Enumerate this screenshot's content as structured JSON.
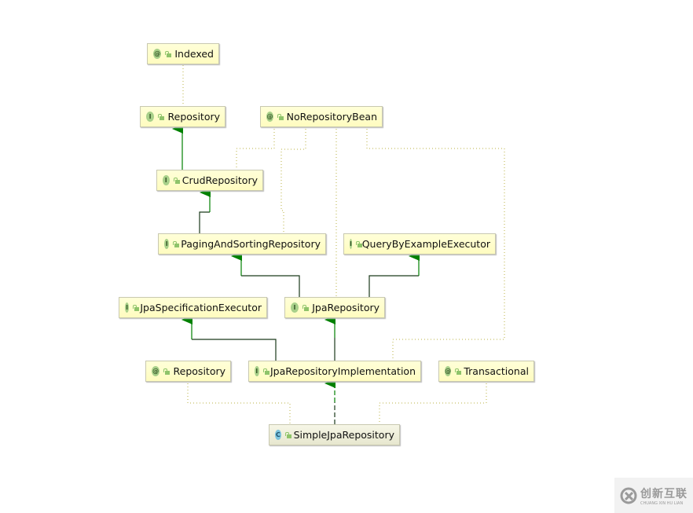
{
  "nodes": [
    {
      "id": "indexed",
      "kind": "annotation",
      "badge": "@",
      "label": "Indexed"
    },
    {
      "id": "repository",
      "kind": "interface",
      "badge": "I",
      "label": "Repository"
    },
    {
      "id": "norepositorybean",
      "kind": "annotation",
      "badge": "@",
      "label": "NoRepositoryBean"
    },
    {
      "id": "crudrepository",
      "kind": "interface",
      "badge": "I",
      "label": "CrudRepository"
    },
    {
      "id": "pagingandsorting",
      "kind": "interface",
      "badge": "I",
      "label": "PagingAndSortingRepository"
    },
    {
      "id": "querybyexample",
      "kind": "interface",
      "badge": "I",
      "label": "QueryByExampleExecutor"
    },
    {
      "id": "jpaspecification",
      "kind": "interface",
      "badge": "I",
      "label": "JpaSpecificationExecutor"
    },
    {
      "id": "jparepository",
      "kind": "interface",
      "badge": "I",
      "label": "JpaRepository"
    },
    {
      "id": "repositoryannotation",
      "kind": "annotation",
      "badge": "@",
      "label": "Repository"
    },
    {
      "id": "jparepoimpl",
      "kind": "interface",
      "badge": "I",
      "label": "JpaRepositoryImplementation"
    },
    {
      "id": "transactional",
      "kind": "annotation",
      "badge": "@",
      "label": "Transactional"
    },
    {
      "id": "simplejparepository",
      "kind": "class",
      "badge": "C",
      "label": "SimpleJpaRepository"
    }
  ],
  "edges": [
    {
      "from": "indexed",
      "to": "repository",
      "type": "annotation"
    },
    {
      "from": "crudrepository",
      "to": "repository",
      "type": "extends"
    },
    {
      "from": "pagingandsorting",
      "to": "crudrepository",
      "type": "extends"
    },
    {
      "from": "jparepository",
      "to": "pagingandsorting",
      "type": "extends"
    },
    {
      "from": "jparepository",
      "to": "querybyexample",
      "type": "extends"
    },
    {
      "from": "jparepoimpl",
      "to": "jpaspecification",
      "type": "extends"
    },
    {
      "from": "jparepoimpl",
      "to": "jparepository",
      "type": "extends"
    },
    {
      "from": "simplejparepository",
      "to": "jparepoimpl",
      "type": "implements"
    },
    {
      "from": "norepositorybean",
      "to": "crudrepository",
      "type": "annotation"
    },
    {
      "from": "norepositorybean",
      "to": "pagingandsorting",
      "type": "annotation"
    },
    {
      "from": "norepositorybean",
      "to": "jparepository",
      "type": "annotation"
    },
    {
      "from": "norepositorybean",
      "to": "jparepoimpl",
      "type": "annotation"
    },
    {
      "from": "repositoryannotation",
      "to": "simplejparepository",
      "type": "annotation"
    },
    {
      "from": "transactional",
      "to": "simplejparepository",
      "type": "annotation"
    }
  ],
  "colors": {
    "arrow": "#008000",
    "annotation_link": "#b8b040",
    "node_fill": "#ffffd0"
  },
  "watermark": {
    "text": "创新互联",
    "subtext": "CHUANG XIN HU LIAN"
  }
}
